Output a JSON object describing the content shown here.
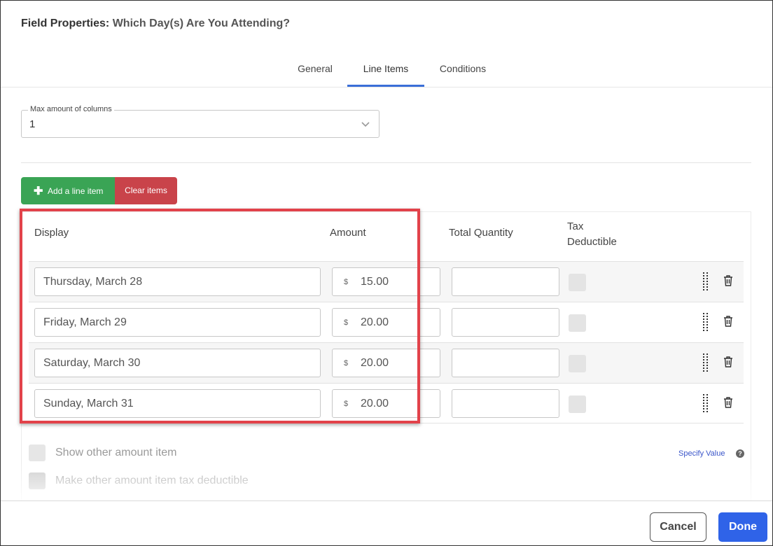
{
  "header": {
    "label": "Field Properties:",
    "field_name": "Which Day(s) Are You Attending?"
  },
  "tabs": [
    {
      "label": "General",
      "active": false
    },
    {
      "label": "Line Items",
      "active": true
    },
    {
      "label": "Conditions",
      "active": false
    }
  ],
  "columns_select": {
    "label": "Max amount of columns",
    "value": "1"
  },
  "actions": {
    "add_label": "Add a line item",
    "clear_label": "Clear items"
  },
  "table": {
    "headers": {
      "display": "Display",
      "amount": "Amount",
      "total_quantity": "Total Quantity",
      "tax_line1": "Tax",
      "tax_line2": "Deductible"
    },
    "currency_symbol": "$",
    "rows": [
      {
        "display": "Thursday, March 28",
        "amount": "15.00",
        "total_quantity": "",
        "tax_deductible": false
      },
      {
        "display": "Friday, March 29",
        "amount": "20.00",
        "total_quantity": "",
        "tax_deductible": false
      },
      {
        "display": "Saturday, March 30",
        "amount": "20.00",
        "total_quantity": "",
        "tax_deductible": false
      },
      {
        "display": "Sunday, March 31",
        "amount": "20.00",
        "total_quantity": "",
        "tax_deductible": false
      }
    ]
  },
  "options": {
    "show_other_amount": "Show other amount item",
    "other_tax_deductible": "Make other amount item tax deductible",
    "specify_value": "Specify Value",
    "help_glyph": "?"
  },
  "footer": {
    "cancel_label": "Cancel",
    "done_label": "Done"
  },
  "colors": {
    "accent": "#2f63e8",
    "add_green": "#3aa455",
    "clear_red": "#c9434a",
    "highlight_red": "#e2424a"
  }
}
